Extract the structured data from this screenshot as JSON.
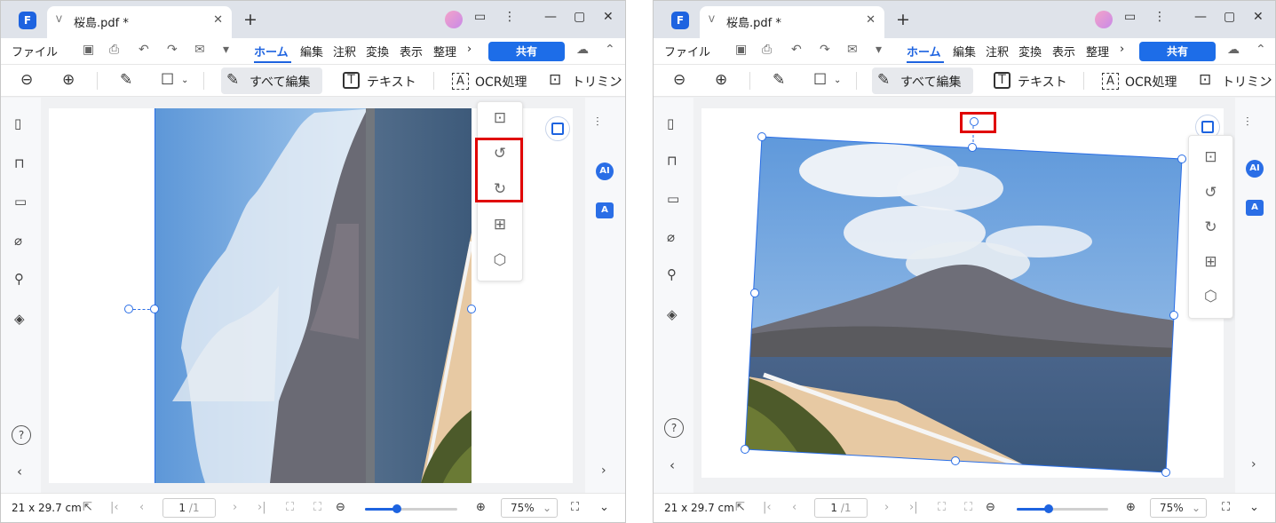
{
  "app": {
    "tab_title": "桜島.pdf *",
    "tab_close": "✕",
    "new_tab": "+"
  },
  "window_controls": {
    "msg": "▭",
    "more": "⋮",
    "minimize": "—",
    "maximize": "▢",
    "close": "✕"
  },
  "menu": {
    "file": "ファイル",
    "home": "ホーム",
    "edit": "編集",
    "comment": "注釈",
    "convert": "変換",
    "view": "表示",
    "organize": "整理",
    "more": "›",
    "share": "共有"
  },
  "toolbar": {
    "edit_all": "すべて編集",
    "text": "テキスト",
    "ocr": "OCR処理",
    "trim": "トリミン",
    "more": "›"
  },
  "icons": {
    "file_chev": "ᐯ",
    "zoom_out": "⊖",
    "zoom_in": "⊕",
    "highlighter": "✎",
    "rect": "☐",
    "pen": "✎",
    "text_box": "T",
    "ocr_box": "A",
    "crop": "⊡",
    "rotate_left": "↺",
    "rotate_right": "↻",
    "replace_image": "⊞",
    "extract": "⬡",
    "page_icon": "▯",
    "bookmark": "⊓",
    "comment": "▭",
    "attach": "⌀",
    "search": "⚲",
    "layers": "◈",
    "help": "?",
    "collapse": "‹",
    "expand": "›",
    "settings": "⫶",
    "cursor": "⇱",
    "first": "|‹",
    "prev": "‹",
    "next": "›",
    "last": "›|",
    "fit": "⛶",
    "down": "⌄"
  },
  "right_panel": {
    "ai": "AI",
    "translate": "A"
  },
  "status": {
    "page_size": "21 x 29.7 cm",
    "page_current": "1",
    "page_total": "/1",
    "zoom": "75%"
  },
  "colors": {
    "accent": "#1d63e0",
    "highlight_box": "#e00000"
  }
}
